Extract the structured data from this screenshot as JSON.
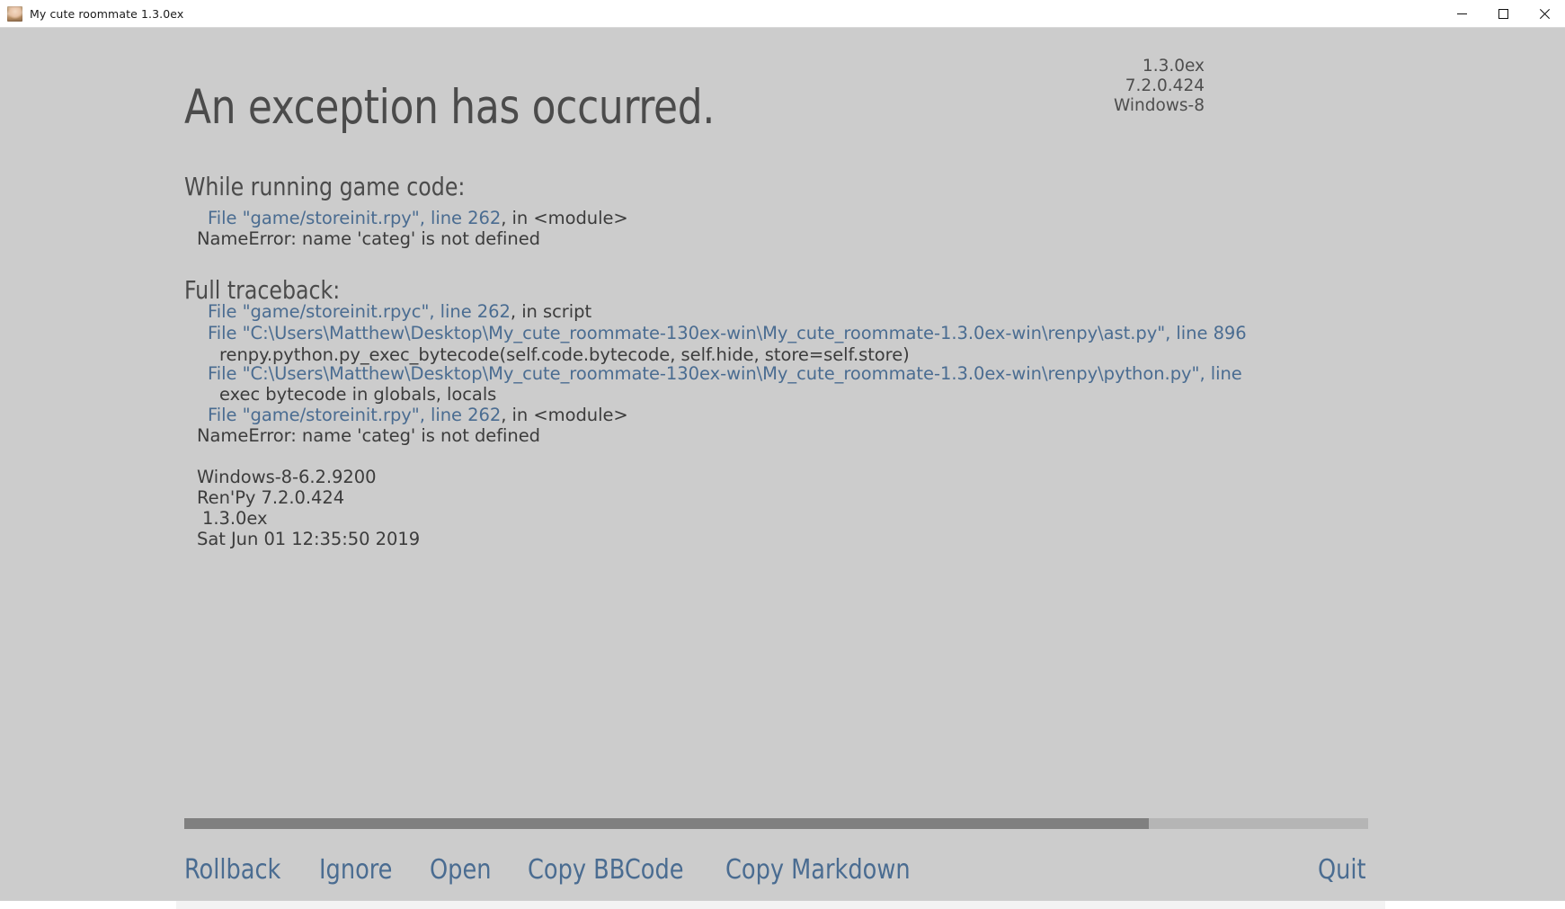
{
  "titlebar": {
    "title": "My cute roommate 1.3.0ex",
    "icon": "app-portrait-icon",
    "minimize_label": "—",
    "maximize_label": "□",
    "close_label": "✕"
  },
  "error_screen": {
    "title": "An exception has occurred.",
    "version_block": {
      "game_version": "1.3.0ex",
      "engine_version": "7.2.0.424",
      "platform": "Windows-8"
    },
    "sections": {
      "running_heading": "While running game code:",
      "traceback_heading": "Full traceback:"
    },
    "running_lines": [
      {
        "link": "File \"game/storeinit.rpy\", line 262",
        "plain": ", in <module>"
      },
      {
        "link": "",
        "plain": "NameError: name 'categ' is not defined"
      }
    ],
    "traceback_lines": [
      {
        "link": "File \"game/storeinit.rpyc\", line 262",
        "plain": ", in script"
      },
      {
        "link": "File \"C:\\Users\\Matthew\\Desktop\\My_cute_roommate-130ex-win\\My_cute_roommate-1.3.0ex-win\\renpy\\ast.py\", line 896",
        "plain": ""
      },
      {
        "link": "",
        "plain": "renpy.python.py_exec_bytecode(self.code.bytecode, self.hide, store=self.store)"
      },
      {
        "link": "File \"C:\\Users\\Matthew\\Desktop\\My_cute_roommate-130ex-win\\My_cute_roommate-1.3.0ex-win\\renpy\\python.py\", line",
        "plain": ""
      },
      {
        "link": "",
        "plain": "exec bytecode in globals, locals"
      },
      {
        "link": "File \"game/storeinit.rpy\", line 262",
        "plain": ", in <module>"
      },
      {
        "link": "",
        "plain": "NameError: name 'categ' is not defined"
      }
    ],
    "environment_lines": [
      "Windows-8-6.2.9200",
      "Ren'Py 7.2.0.424",
      "1.3.0ex",
      "Sat Jun 01 12:35:50 2019"
    ],
    "scrollbar": {
      "thumb_percent": "81.5%"
    },
    "buttons": [
      {
        "label": "Rollback",
        "name": "rollback"
      },
      {
        "label": "Ignore",
        "name": "ignore"
      },
      {
        "label": "Open",
        "name": "open"
      },
      {
        "label": "Copy BBCode",
        "name": "copy-bbcode"
      },
      {
        "label": "Copy Markdown",
        "name": "copy-markdown"
      }
    ],
    "quit_button": "Quit"
  },
  "colors": {
    "screen_background": "#cccccc",
    "link": "#4a6c91",
    "text": "#3c3c3c",
    "heading": "#4b4b4b",
    "scrollbar_thumb": "#808080",
    "scrollbar_track": "#b5b5b5"
  }
}
